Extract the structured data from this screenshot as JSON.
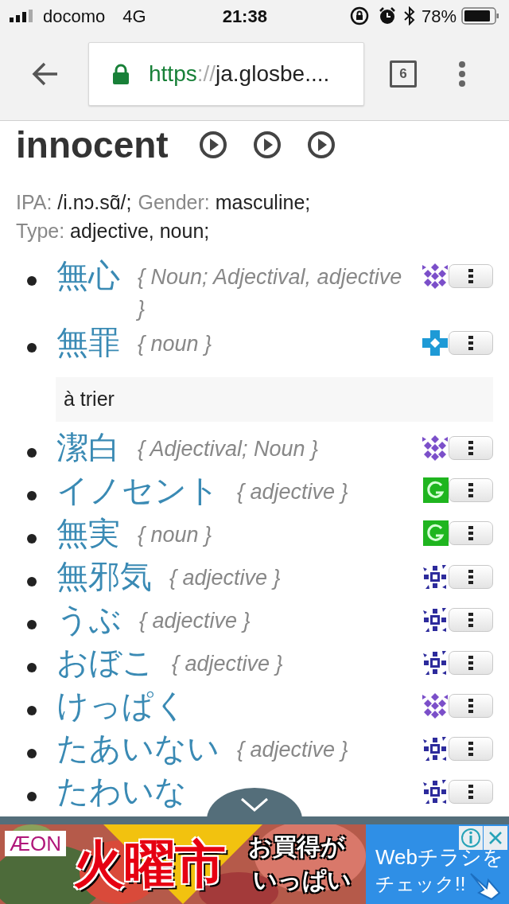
{
  "status_bar": {
    "carrier": "docomo",
    "network": "4G",
    "time": "21:38",
    "battery": "78%"
  },
  "browser": {
    "url_scheme": "https",
    "url_separator": "://",
    "url_host": "ja.glosbe....",
    "tab_count": "6"
  },
  "entry": {
    "headword": "innocent",
    "info": [
      {
        "label": "IPA:",
        "value": "/i.nɔ.sɑ̃/;"
      },
      {
        "label": "Gender:",
        "value": "masculine;"
      },
      {
        "label": "Type:",
        "value": "adjective, noun;"
      }
    ],
    "translations": [
      {
        "word": "無心",
        "tag": "{ Noun; Adjectival, adjective }",
        "source": {
          "kind": "diamonds",
          "color": "#7b4fc9"
        }
      },
      {
        "word": "無罪",
        "tag": "{ noun }",
        "source": {
          "kind": "cross",
          "color": "#1e9ad6"
        }
      }
    ],
    "unsorted_heading": "à trier",
    "unsorted": [
      {
        "word": "潔白",
        "tag": "{ Adjectival; Noun }",
        "source": {
          "kind": "diamonds",
          "color": "#7b4fc9"
        }
      },
      {
        "word": "イノセント",
        "tag": "{ adjective }",
        "source": {
          "kind": "google",
          "color": "#1fb51f"
        }
      },
      {
        "word": "無実",
        "tag": "{ noun }",
        "source": {
          "kind": "google",
          "color": "#1fb51f"
        }
      },
      {
        "word": "無邪気",
        "tag": "{ adjective }",
        "source": {
          "kind": "square",
          "color": "#2d2b9c"
        }
      },
      {
        "word": "うぶ",
        "tag": "{ adjective }",
        "source": {
          "kind": "square",
          "color": "#2d2b9c"
        }
      },
      {
        "word": "おぼこ",
        "tag": "{ adjective }",
        "source": {
          "kind": "square",
          "color": "#2d2b9c"
        }
      },
      {
        "word": "けっぱく",
        "source": {
          "kind": "diamonds",
          "color": "#7b4fc9"
        }
      },
      {
        "word": "たあいない",
        "tag": "{ adjective }",
        "source": {
          "kind": "square",
          "color": "#2d2b9c"
        }
      },
      {
        "word": "たわいな",
        "source": {
          "kind": "square",
          "color": "#2d2b9c"
        }
      }
    ]
  },
  "ad": {
    "logo": "ÆON",
    "headline": "火曜市",
    "slogan_1": "お買得が",
    "slogan_2": "いっぱい",
    "cta_1": "Webチラシを",
    "cta_2": "チェック!!"
  }
}
